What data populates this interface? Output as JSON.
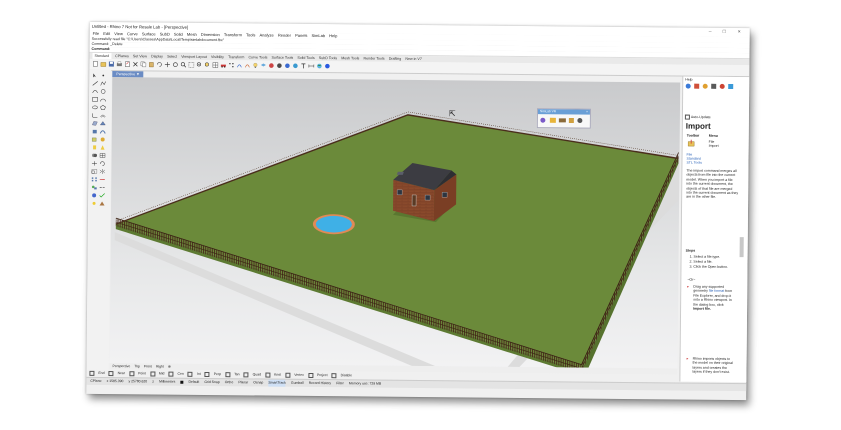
{
  "window": {
    "title": "Untitled - Rhino 7 Not for Resale Lab - [Perspective]",
    "controls": {
      "minimize": "–",
      "maximize": "□",
      "close": "×"
    }
  },
  "menu": [
    "File",
    "Edit",
    "View",
    "Curve",
    "Surface",
    "SubD",
    "Solid",
    "Mesh",
    "Dimension",
    "Transform",
    "Tools",
    "Analyze",
    "Render",
    "Panels",
    "SimLab",
    "Help"
  ],
  "command_history": {
    "line1": "Successfully read file \"C:\\Users\\Classes\\AppData\\Local\\Temp\\simlabdocument.fbx\"",
    "line2": "Command: _Delete",
    "prompt": "Command:"
  },
  "toolbar_tabs": [
    "Standard",
    "CPlanes",
    "Set View",
    "Display",
    "Select",
    "Viewport Layout",
    "Visibility",
    "Transform",
    "Curve Tools",
    "Surface Tools",
    "Solid Tools",
    "SubD Tools",
    "Mesh Tools",
    "Render Tools",
    "Drafting",
    "New in V7"
  ],
  "viewport": {
    "name": "Perspective",
    "name_arrow": "▼",
    "colors": {
      "grass": "#6b8a3a",
      "grass_dark": "#5d7a32",
      "fence": "#4a2e1c",
      "house": "#8a4a2c",
      "roof": "#3c3c42",
      "pool": "#3fb0e6",
      "pool_rim": "#e08a56"
    }
  },
  "plugin_window": {
    "title": "SimLab VR",
    "close": "×"
  },
  "viewport_tabs": [
    "Perspective",
    "Top",
    "Front",
    "Right",
    "⊕"
  ],
  "osnaps": [
    "End",
    "Near",
    "Point",
    "Mid",
    "Cen",
    "Int",
    "Perp",
    "Tan",
    "Quad",
    "Knot",
    "Vertex",
    "Project",
    "Disable"
  ],
  "status_bar": {
    "cplane": "CPlane",
    "x": "x 1585.390",
    "y": "y 25780.620",
    "z": "z",
    "units": "Millimeters",
    "layer": "Default",
    "items": [
      "Grid Snap",
      "Ortho",
      "Planar",
      "Osnap",
      "SmartTrack",
      "Gumball",
      "Record History",
      "Filter"
    ],
    "active_item": "SmartTrack",
    "memory": "Memory use: 729 MB"
  },
  "help_panel": {
    "header": "Help",
    "auto_update": "Auto-Update",
    "title": "Import",
    "col_toolbar": "Toolbar",
    "col_menu": "Menu",
    "menu_entry": "File Import",
    "toolbar_links": [
      "File",
      "Standard",
      "STL Tools"
    ],
    "description": "The import command merges all objects from file into the current model. When you import a file into the current document, the objects of that file are merged into the current document as they are in the other file.",
    "steps_title": "Steps",
    "steps": [
      "1. Select a file type.",
      "2. Select a file.",
      "3. Click the Open button."
    ],
    "or": "~Or~",
    "bullet1_pre": "Drag any supported geometry",
    "bullet1_link": "file format",
    "bullet1_post": "from File Explorer, and drop it onto a Rhino viewport. In the dialog box, click",
    "bullet1_bold": "Import file.",
    "bullet2": "Rhino imports objects to the model on their original layers and creates the layers if they don't exist."
  }
}
